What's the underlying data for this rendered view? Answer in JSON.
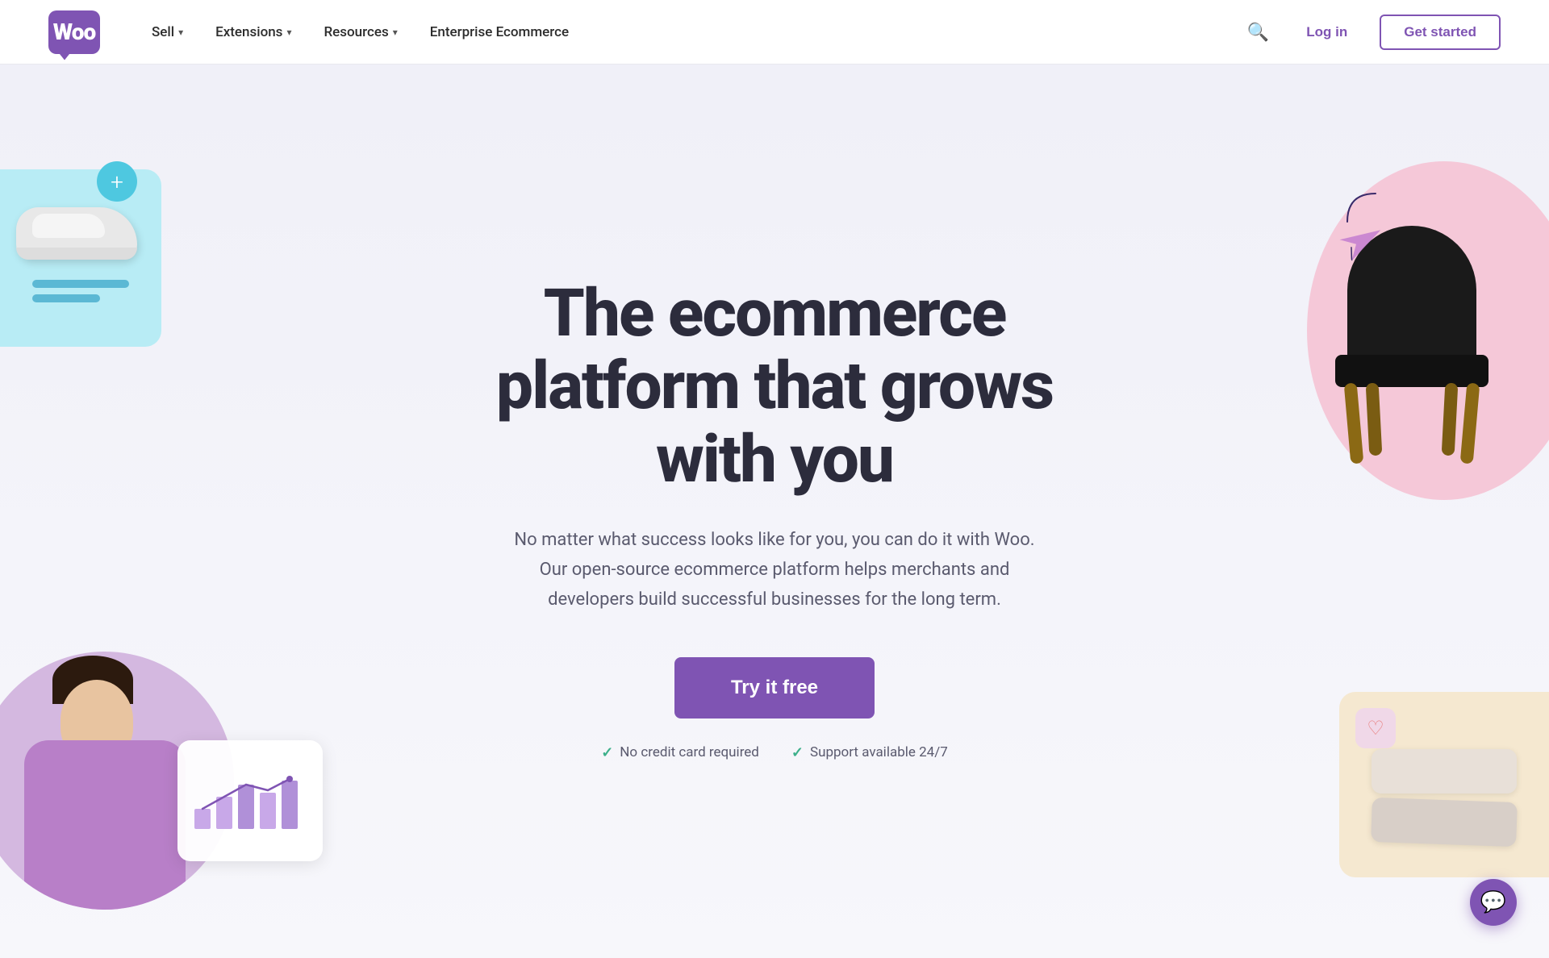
{
  "nav": {
    "logo_text": "Woo",
    "items": [
      {
        "label": "Sell",
        "has_dropdown": true
      },
      {
        "label": "Extensions",
        "has_dropdown": true
      },
      {
        "label": "Resources",
        "has_dropdown": true
      },
      {
        "label": "Enterprise Ecommerce",
        "has_dropdown": false
      }
    ],
    "login_label": "Log in",
    "get_started_label": "Get started"
  },
  "hero": {
    "title": "The ecommerce platform that grows with you",
    "subtitle": "No matter what success looks like for you, you can do it with Woo. Our open-source ecommerce platform helps merchants and developers build successful businesses for the long term.",
    "cta_label": "Try it free",
    "badge1": "No credit card required",
    "badge2": "Support available 24/7"
  },
  "colors": {
    "brand_purple": "#7f54b3",
    "brand_light_blue": "#b8ecf5",
    "brand_pink": "#f5c8d8",
    "brand_peach": "#f5e8d0",
    "check_green": "#3db08a"
  },
  "icons": {
    "search": "🔍",
    "chevron_down": "▾",
    "check": "✓",
    "chat": "💬",
    "heart": "♡",
    "plus": "+",
    "send": "▷"
  }
}
